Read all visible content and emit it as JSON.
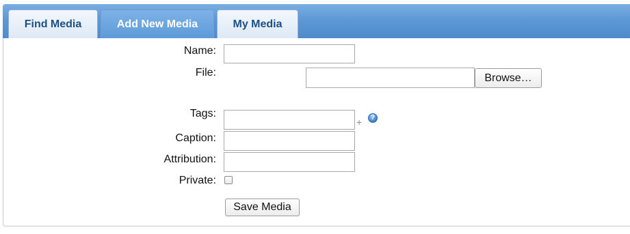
{
  "tabs": {
    "find": "Find Media",
    "add": "Add New Media",
    "my": "My Media"
  },
  "form": {
    "name_label": "Name:",
    "name_value": "",
    "file_label": "File:",
    "file_value": "",
    "browse_label": "Browse…",
    "tags_label": "Tags:",
    "tags_value": "",
    "add_tag_symbol": "+",
    "help_symbol": "?",
    "caption_label": "Caption:",
    "caption_value": "",
    "attribution_label": "Attribution:",
    "attribution_value": "",
    "private_label": "Private:",
    "private_checked": false,
    "save_label": "Save Media"
  },
  "colors": {
    "tab_bar": "#5d98d6",
    "tab_text": "#1c4f86",
    "active_tab_text": "#ffffff"
  }
}
